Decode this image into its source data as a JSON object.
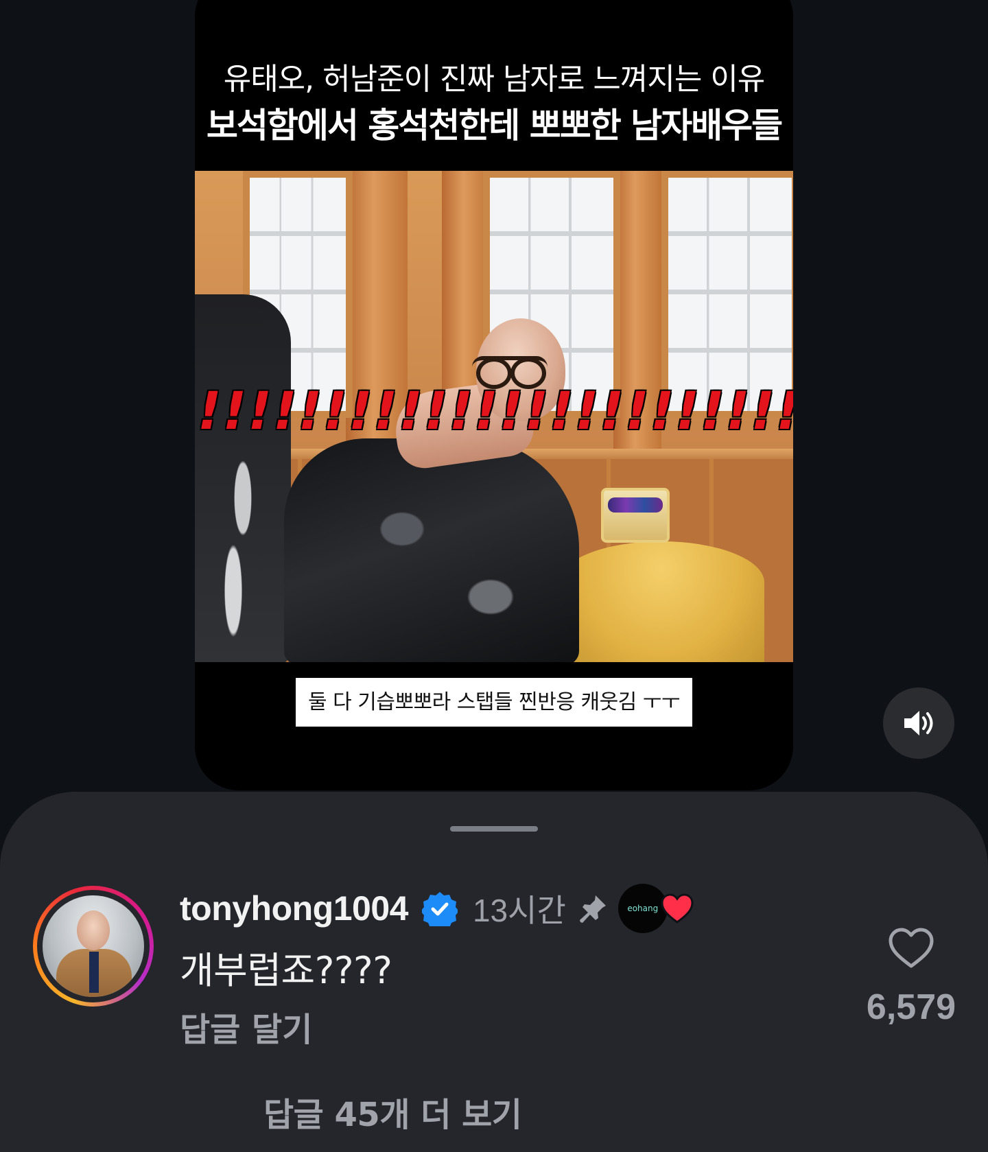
{
  "video": {
    "title_line1": "유태오, 허남준이 진짜 남자로 느껴지는 이유",
    "title_line2": "보석함에서 홍석천한테 뽀뽀한 남자배우들",
    "overlay_text": "!!!!!!!!!!!!!!!!!!!!!!!!!",
    "caption": "둘 다 기습뽀뽀라 스탭들 찐반응 캐웃김 ㅜㅜ",
    "sound_icon": "speaker-on-icon"
  },
  "comment": {
    "username": "tonyhong1004",
    "verified": true,
    "time": "13시간",
    "pinned": true,
    "creator_avatar_text": "eohang",
    "creator_liked": true,
    "text": "개부럽죠????",
    "reply_label": "답글 달기",
    "like_count": "6,579",
    "more_replies": "답글 45개 더 보기"
  },
  "colors": {
    "background": "#0e1217",
    "sheet": "#24262b",
    "verified_blue": "#1d8cf8",
    "heart_red": "#ff2f4a",
    "exclaim_red": "#e3141b"
  }
}
